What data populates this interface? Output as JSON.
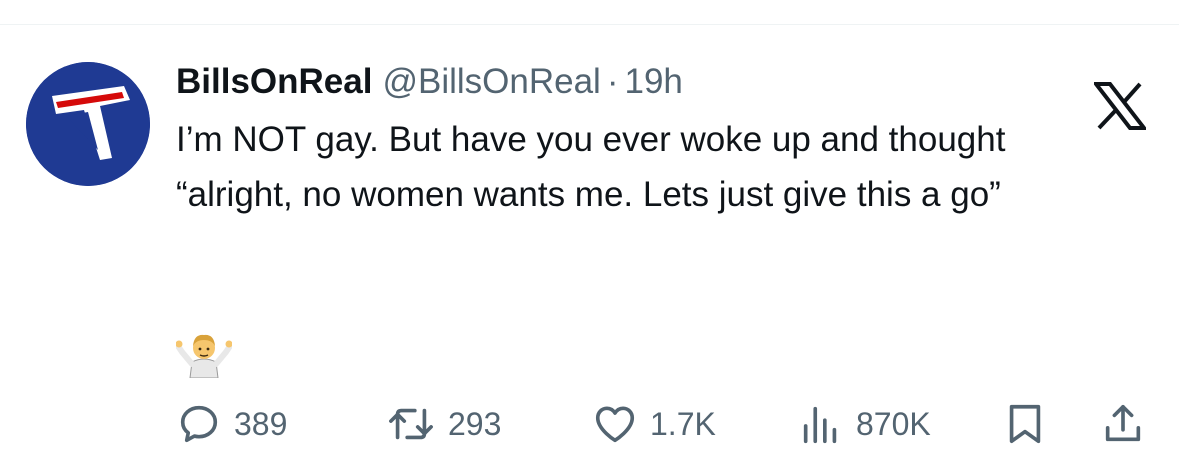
{
  "tweet": {
    "author": {
      "display_name": "BillsOnReal",
      "handle": "@BillsOnReal",
      "avatar_icon": "bills-logo-icon",
      "avatar_color": "#1f3a93"
    },
    "separator": "·",
    "time": "19h",
    "text": "I’m NOT gay. But have you ever woke up and thought “alright, no women wants me. Lets just give this a go”",
    "emoji_icon": "person-shrugging-icon"
  },
  "platform_icon": "x-logo-icon",
  "actions": {
    "reply": {
      "icon": "reply-icon",
      "count": "389"
    },
    "retweet": {
      "icon": "retweet-icon",
      "count": "293"
    },
    "like": {
      "icon": "heart-icon",
      "count": "1.7K"
    },
    "views": {
      "icon": "views-icon",
      "count": "870K"
    },
    "bookmark": {
      "icon": "bookmark-icon"
    },
    "share": {
      "icon": "share-icon"
    }
  },
  "colors": {
    "text": "#0f1419",
    "secondary": "#536471",
    "divider": "#eff3f4"
  }
}
